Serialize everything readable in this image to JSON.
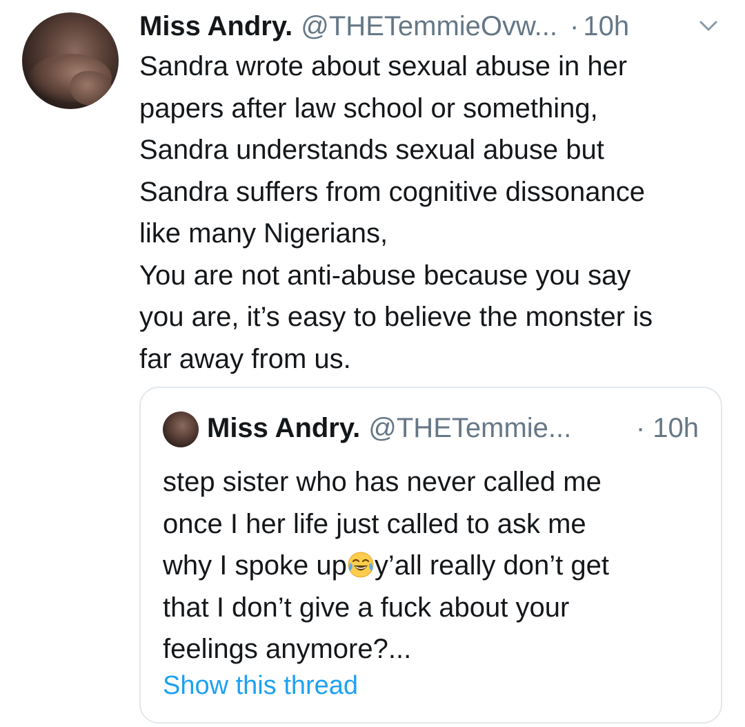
{
  "tweet": {
    "author_name": "Miss Andry.",
    "author_handle": "@THETemmieOvw...",
    "separator": "·",
    "time": "10h",
    "caret_icon": "chevron-down-icon",
    "avatar_icon": "profile-photo",
    "text_lines": [
      "Sandra wrote about sexual abuse in her",
      "papers after law school or something,",
      "Sandra understands sexual abuse but",
      "Sandra suffers from cognitive dissonance",
      "like many Nigerians,",
      "You are not anti-abuse because you say",
      "you are, it’s easy to believe the monster is",
      "far away from us."
    ]
  },
  "quoted": {
    "author_name": "Miss Andry.",
    "author_handle": "@THETemmie...",
    "time": "· 10h",
    "avatar_icon": "profile-photo",
    "text_lines": [
      "step sister who has never called me",
      "once I her life just called to ask me",
      "y’all really don’t get",
      "that I don’t give a fuck about your",
      "feelings anymore?..."
    ],
    "line3_prefix": "why I spoke up",
    "emoji_icon": "face-with-tears-of-joy-icon",
    "show_thread_label": "Show this thread"
  },
  "colors": {
    "text": "#14171a",
    "secondary": "#657786",
    "link": "#1da1f2",
    "border": "#e1e8ed"
  }
}
